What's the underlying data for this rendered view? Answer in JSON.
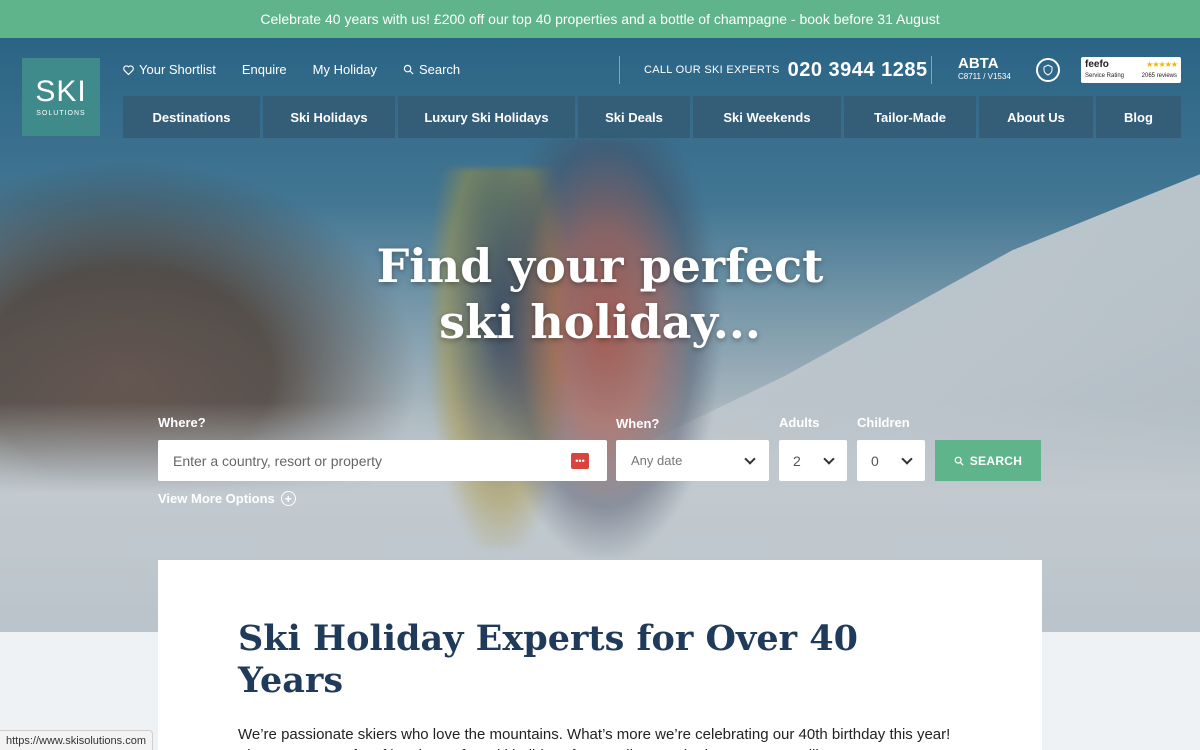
{
  "promo": {
    "text": "Celebrate 40 years with us! £200 off our top 40 properties and a bottle of champagne - book before 31 August"
  },
  "logo": {
    "big": "SKI",
    "small": "SOLUTIONS"
  },
  "util_nav": {
    "shortlist": "Your Shortlist",
    "enquire": "Enquire",
    "my_holiday": "My Holiday",
    "search": "Search"
  },
  "phone": {
    "label": "CALL OUR SKI EXPERTS",
    "number": "020 3944 1285"
  },
  "abta": {
    "name": "ABTA",
    "code": "C8711 / V1534"
  },
  "feefo": {
    "brand": "feefo",
    "rating_label": "Service Rating",
    "reviews": "2065 reviews",
    "stars": "★★★★★"
  },
  "main_nav": {
    "items": [
      "Destinations",
      "Ski Holidays",
      "Luxury Ski Holidays",
      "Ski Deals",
      "Ski Weekends",
      "Tailor-Made",
      "About Us",
      "Blog"
    ]
  },
  "hero": {
    "line1": "Find your perfect",
    "line2": "ski holiday..."
  },
  "search_form": {
    "where_label": "Where?",
    "where_placeholder": "Enter a country, resort or property",
    "when_label": "When?",
    "when_value": "Any date",
    "adults_label": "Adults",
    "adults_value": "2",
    "children_label": "Children",
    "children_value": "0",
    "search_button": "SEARCH",
    "more_options": "View More Options"
  },
  "content": {
    "heading": "Ski Holiday Experts for Over 40 Years",
    "paragraph": "We’re passionate skiers who love the mountains. What’s more we’re celebrating our 40th birthday this year! That’s 40 years of crafting the perfect ski holidays for our clients. Whether you’re travelling as a group, a couple, solo or with the family, we will make sure you have a memorable experience that’s"
  },
  "status_bar": {
    "url": "https://www.skisolutions.com"
  },
  "colors": {
    "promo_green": "#5fb48c",
    "nav_blue": "#345c76",
    "logo_teal": "#3f8b8c",
    "heading_navy": "#1f3a5a"
  }
}
